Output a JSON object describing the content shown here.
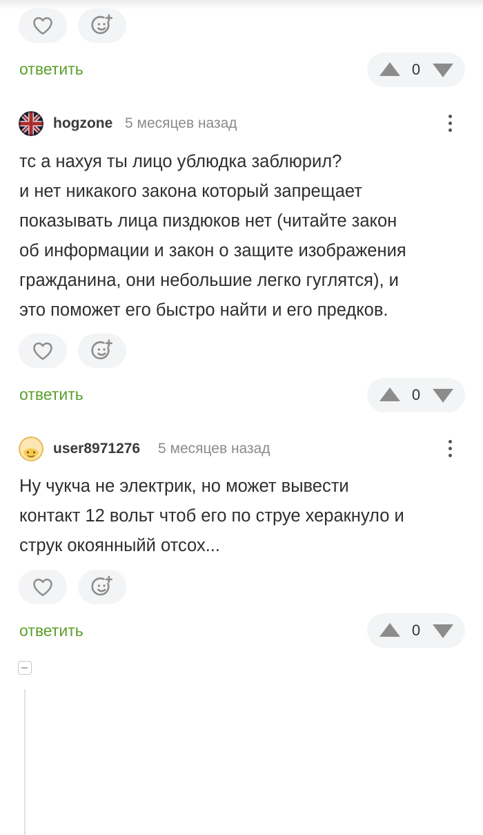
{
  "colors": {
    "reply": "#5b9e2a",
    "pill_bg": "#f3f4f5",
    "icon": "#8c8c8c"
  },
  "reply_label": "ответить",
  "top_actions": {
    "vote_count": "0"
  },
  "comments": [
    {
      "username": "hogzone",
      "time": "5 месяцев назад",
      "avatar": "union-jack-avatar",
      "lines": [
        "тс а нахуя ты лицо ублюдка заблюрил?",
        "и нет никакого закона который запрещает",
        "показывать лица пиздюков нет (читайте закон",
        "об информации и закон о защите изображения",
        "гражданина, они небольшие легко гуглятся), и",
        "это поможет его быстро найти и его предков."
      ],
      "vote_count": "0"
    },
    {
      "username": "user8971276",
      "time": "5 месяцев назад",
      "avatar": "yellow-face-avatar",
      "lines": [
        "Ну чукча не электрик, но может вывести",
        "контакт 12 вольт чтоб его по струе херакнуло и",
        "струк окоянныйй отсох..."
      ],
      "vote_count": "0"
    }
  ],
  "icons": {
    "like": "heart-icon",
    "react": "add-emoji-icon",
    "upvote": "upvote-arrow-icon",
    "downvote": "downvote-arrow-icon",
    "menu": "more-vertical-icon",
    "collapse": "collapse-thread-icon"
  }
}
